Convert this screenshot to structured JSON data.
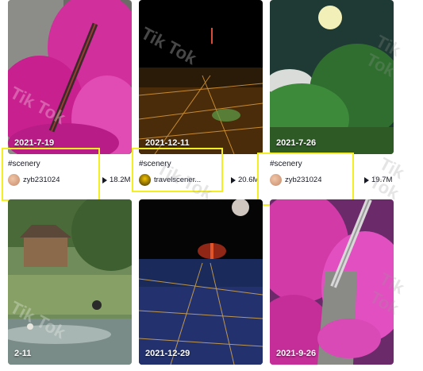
{
  "cards": [
    {
      "date": "2021-7-19",
      "tag": "#scenery",
      "user": "zyb231024",
      "views": "18.2M"
    },
    {
      "date": "2021-12-11",
      "tag": "#scenery",
      "user": "travelscener...",
      "views": "20.6M"
    },
    {
      "date": "2021-7-26",
      "tag": "#scenery",
      "user": "zyb231024",
      "views": "19.7M"
    },
    {
      "date": "2-11"
    },
    {
      "date": "2021-12-29"
    },
    {
      "date": "2021-9-26"
    }
  ],
  "watermark": "Tik Tok",
  "colors": {
    "highlight": "#f4ef22",
    "text": "#161823"
  }
}
